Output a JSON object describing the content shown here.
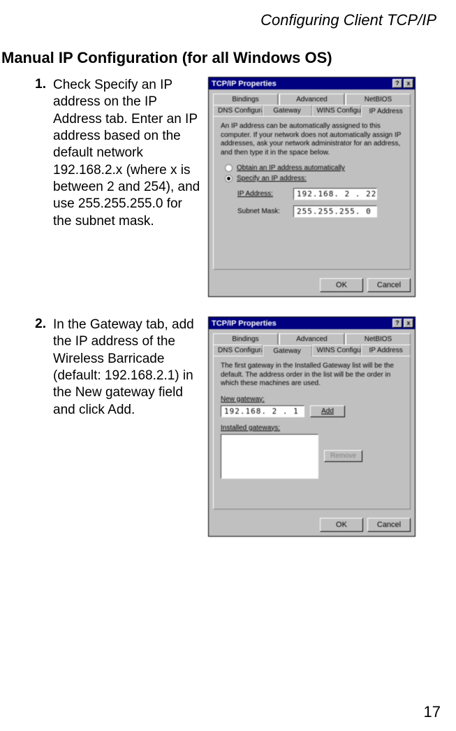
{
  "header": {
    "running": "Configuring Client TCP/IP"
  },
  "section": {
    "title": "Manual IP Configuration (for all Windows OS)"
  },
  "steps": {
    "s1": {
      "num": "1.",
      "text": "Check Specify an IP address on the IP Address tab. Enter an IP address based on the default network 192.168.2.x (where x is between 2 and 254), and use 255.255.255.0 for the subnet mask."
    },
    "s2": {
      "num": "2.",
      "text": "In the Gateway tab, add the IP address of the Wireless Barricade (default: 192.168.2.1) in the New gateway field and click Add."
    }
  },
  "dialog": {
    "title": "TCP/IP Properties",
    "help": "?",
    "close": "x",
    "tabs": {
      "bindings": "Bindings",
      "advanced": "Advanced",
      "netbios": "NetBIOS",
      "dns": "DNS Configuration",
      "gateway": "Gateway",
      "wins": "WINS Configuration",
      "ipaddr": "IP Address"
    },
    "ok": "OK",
    "cancel": "Cancel"
  },
  "dlg1": {
    "desc": "An IP address can be automatically assigned to this computer. If your network does not automatically assign IP addresses, ask your network administrator for an address, and then type it in the space below.",
    "opt_auto": "Obtain an IP address automatically",
    "opt_spec": "Specify an IP address:",
    "ip_label": "IP Address:",
    "ip_value": "192.168. 2 . 22",
    "mask_label": "Subnet Mask:",
    "mask_value": "255.255.255. 0"
  },
  "dlg2": {
    "desc": "The first gateway in the Installed Gateway list will be the default. The address order in the list will be the order in which these machines are used.",
    "new_label": "New gateway:",
    "new_value": "192.168. 2 . 1",
    "add": "Add",
    "installed_label": "Installed gateways:",
    "remove": "Remove"
  },
  "page": {
    "num": "17"
  }
}
